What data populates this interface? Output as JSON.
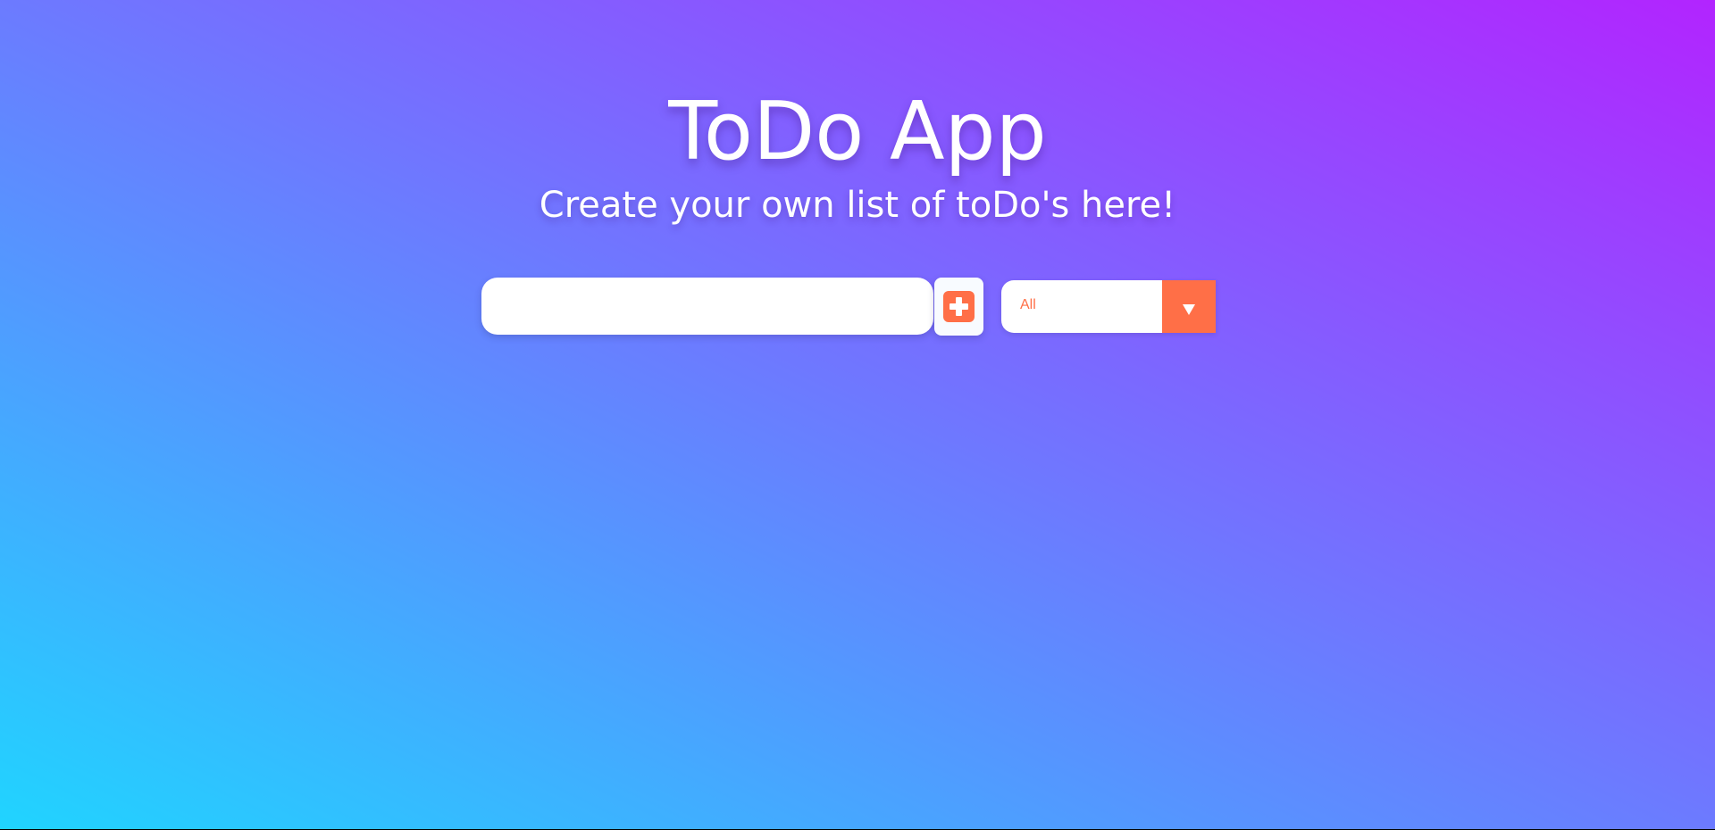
{
  "app": {
    "title": "ToDo App",
    "subtitle": "Create your own list of toDo's here!"
  },
  "form": {
    "input_value": "",
    "input_placeholder": "",
    "add_icon": "plus-square-icon",
    "filter_selected": "All",
    "filter_icon": "chevron-down-icon"
  },
  "colors": {
    "accent": "#ff6f47",
    "gradient_start": "#20d4ff",
    "gradient_end": "#b224ff",
    "text": "#ffffff"
  }
}
